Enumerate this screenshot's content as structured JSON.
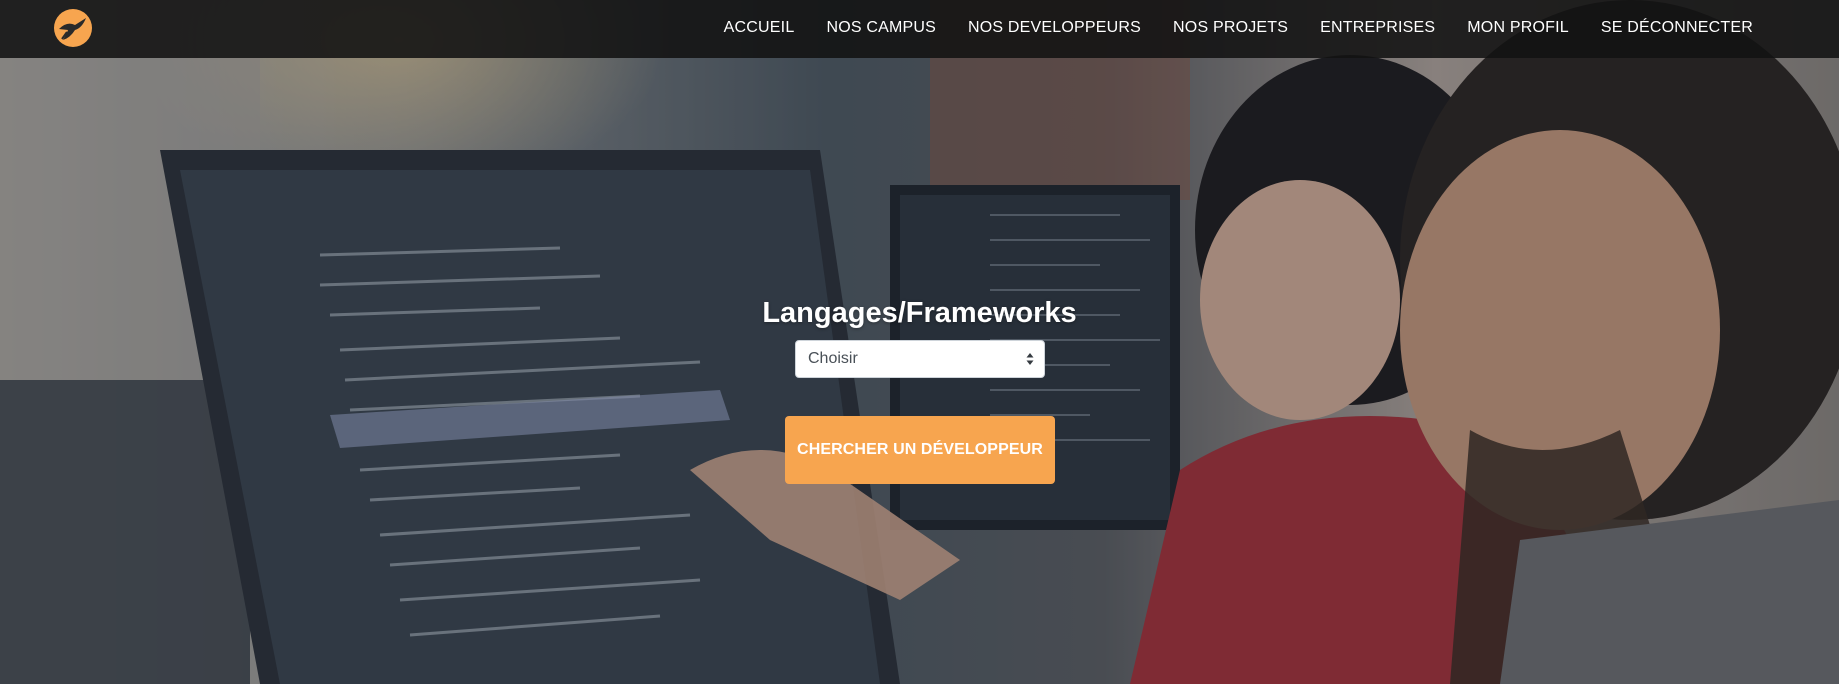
{
  "colors": {
    "accent": "#f7a54f",
    "navbar_bg": "#121212",
    "nav_text": "#ffffff"
  },
  "navbar": {
    "logo_icon": "bird-logo-icon",
    "links": [
      {
        "label": "ACCUEIL"
      },
      {
        "label": "NOS CAMPUS"
      },
      {
        "label": "NOS DEVELOPPEURS"
      },
      {
        "label": "NOS PROJETS"
      },
      {
        "label": "ENTREPRISES"
      },
      {
        "label": "MON PROFIL"
      },
      {
        "label": "SE DÉCONNECTER"
      }
    ]
  },
  "search": {
    "title": "Langages/Frameworks",
    "select": {
      "selected": "Choisir",
      "icon": "select-arrows-icon"
    },
    "button_label": "CHERCHER UN DÉVELOPPEUR"
  },
  "hero": {
    "image": "developers-office-photo"
  }
}
